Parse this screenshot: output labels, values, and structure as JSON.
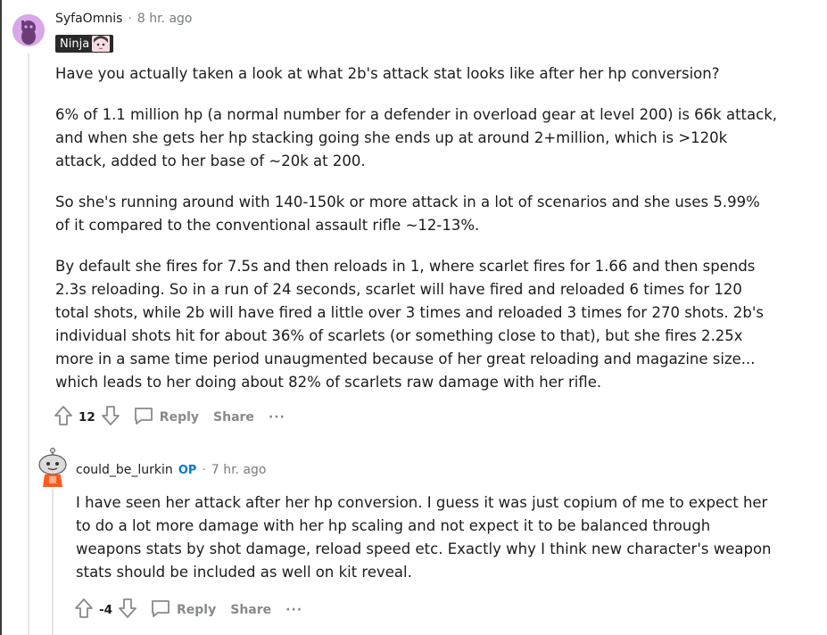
{
  "comment1": {
    "username": "SyfaOmnis",
    "separator": "·",
    "time": "8 hr. ago",
    "flair_text": "Ninja",
    "paragraphs": [
      "Have you actually taken a look at what 2b's attack stat looks like after her hp conversion?",
      "6% of 1.1 million hp (a normal number for a defender in overload gear at level 200) is 66k attack, and when she gets her hp stacking going she ends up at around 2+million, which is >120k attack, added to her base of ~20k at 200.",
      "So she's running around with 140-150k or more attack in a lot of scenarios and she uses 5.99% of it compared to the conventional assault rifle ~12-13%.",
      "By default she fires for 7.5s and then reloads in 1, where scarlet fires for 1.66 and then spends 2.3s reloading. So in a run of 24 seconds, scarlet will have fired and reloaded 6 times for 120 total shots, while 2b will have fired a little over 3 times and reloaded 3 times for 270 shots. 2b's individual shots hit for about 36% of scarlets (or something close to that), but she fires 2.25x more in a same time period unaugmented because of her great reloading and magazine size... which leads to her doing about 82% of scarlets raw damage with her rifle."
    ],
    "vote_count": "12",
    "reply_label": "Reply",
    "share_label": "Share",
    "more_label": "···"
  },
  "comment2": {
    "username": "could_be_lurkin",
    "op_badge": "OP",
    "separator": "·",
    "time": "7 hr. ago",
    "paragraphs": [
      "I have seen her attack after her hp conversion. I guess it was just copium of me to expect her to do a lot more damage with her hp scaling and not expect it to be balanced through weapons stats by shot damage, reload speed etc. Exactly why I think new character's weapon stats should be included as well on kit reveal."
    ],
    "vote_count": "-4",
    "reply_label": "Reply",
    "share_label": "Share",
    "more_label": "···"
  },
  "icons": [
    "upvote-icon",
    "downvote-icon",
    "comment-icon",
    "more-icon"
  ],
  "colors": {
    "op_badge": "#0079d3",
    "meta_gray": "#787c7e",
    "flair_bg": "#2a2a2a"
  }
}
